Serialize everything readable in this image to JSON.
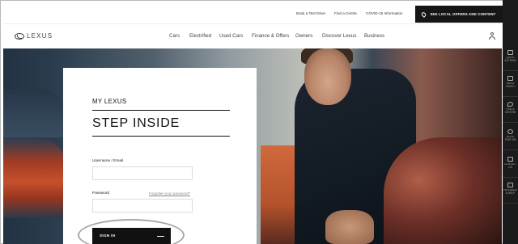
{
  "utility": {
    "links": [
      "Book a Test Drive",
      "Find a Centre",
      "COVID-19 Information"
    ],
    "offers_label": "SEE LOCAL OFFERS AND CONTENT"
  },
  "nav": {
    "logo_text": "LEXUS",
    "items": [
      "Cars",
      "Electrified",
      "Used Cars",
      "Finance & Offers",
      "Owners",
      "Discover Lexus",
      "Business"
    ]
  },
  "login": {
    "kicker": "MY LEXUS",
    "title": "STEP INSIDE",
    "username_label": "Username / Email",
    "username_value": "",
    "password_label": "Password",
    "password_value": "",
    "forgot_label": "Forgotten your password?",
    "signin_label": "SIGN IN"
  },
  "quick_rail": {
    "items": [
      {
        "icon": "menu-icon",
        "label": "QUICK ACTIONS"
      },
      {
        "icon": "car-icon",
        "label": "BUILD YOUR L"
      },
      {
        "icon": "location-pin-icon",
        "label": "FIND A CENTRE"
      },
      {
        "icon": "steering-wheel-icon",
        "label": "BOOK TEST DR"
      },
      {
        "icon": "mail-icon",
        "label": "CONTACT US"
      },
      {
        "icon": "feedback-icon",
        "label": "FEEDBACK & HELP"
      }
    ]
  },
  "colors": {
    "dark": "#161616",
    "accent_white": "#ffffff",
    "annotation": "#a7a7a7"
  }
}
